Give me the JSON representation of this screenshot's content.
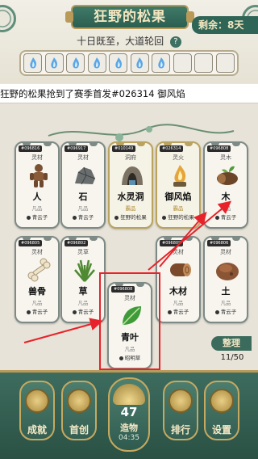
{
  "header": {
    "title": "狂野的松果",
    "remaining": "剩余：8天",
    "subtitle": "十日既至，大道轮回",
    "help_icon": "?",
    "slots_total": 10,
    "slots_filled": 7
  },
  "broadcast": {
    "text": "狂野的松果抢到了赛季首发#026314 御风焰"
  },
  "board": {
    "cards": [
      {
        "id": "#096816",
        "type": "灵材",
        "name": "人",
        "rarity": "凡品",
        "owner": "青云子",
        "icon": "wooden-figure-icon"
      },
      {
        "id": "#096917",
        "type": "灵材",
        "name": "石",
        "rarity": "凡品",
        "owner": "青云子",
        "icon": "rock-icon"
      },
      {
        "id": "#010149",
        "type": "洞府",
        "name": "水灵洞",
        "rarity": "霸品",
        "owner": "狂野的松果",
        "icon": "water-cave-icon"
      },
      {
        "id": "#026314",
        "type": "灵火",
        "name": "御风焰",
        "rarity": "霸品",
        "owner": "狂野的松果",
        "icon": "wind-flame-icon"
      },
      {
        "id": "#096808",
        "type": "灵木",
        "name": "木",
        "rarity": "凡品",
        "owner": "青云子",
        "icon": "sprouting-log-icon"
      },
      {
        "id": "#096805",
        "type": "灵材",
        "name": "兽骨",
        "rarity": "凡品",
        "owner": "青云子",
        "icon": "bone-icon"
      },
      {
        "id": "#096802",
        "type": "灵草",
        "name": "草",
        "rarity": "凡品",
        "owner": "青云子",
        "icon": "grass-icon"
      },
      {
        "id": "#096809",
        "type": "灵材",
        "name": "木材",
        "rarity": "凡品",
        "owner": "青云子",
        "icon": "log-icon"
      },
      {
        "id": "#096806",
        "type": "灵材",
        "name": "土",
        "rarity": "凡品",
        "owner": "青云子",
        "icon": "soil-icon"
      },
      {
        "id": "#096808",
        "type": "灵材",
        "name": "青叶",
        "rarity": "凡品",
        "owner": "昭明草",
        "icon": "leaf-icon"
      }
    ],
    "sort_label": "整理",
    "count": "11/50"
  },
  "bottom_nav": {
    "achievements": "成就",
    "first_creation": "首创",
    "creation_count": "47",
    "creation_label": "造物",
    "creation_time": "04:35",
    "ranking": "排行",
    "settings": "设置"
  },
  "colors": {
    "primary_green": "#2f6556",
    "gold_trim": "#b99a58",
    "arrow_red": "#e8222a"
  }
}
